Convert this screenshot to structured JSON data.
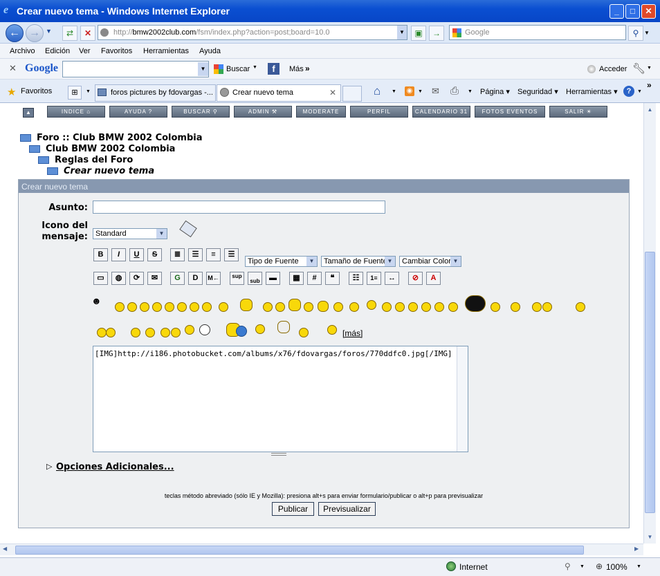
{
  "window": {
    "title": "Crear nuevo tema - Windows Internet Explorer"
  },
  "address": {
    "url_prefix": "http://",
    "url_domain": "bmw2002club.com",
    "url_path": "/fsm/index.php?action=post;board=10.0",
    "search_placeholder": "Google"
  },
  "menu": [
    "Archivo",
    "Edición",
    "Ver",
    "Favoritos",
    "Herramientas",
    "Ayuda"
  ],
  "google_bar": {
    "logo": "Google",
    "search_label": "Buscar",
    "more_label": "Más",
    "signin": "Acceder"
  },
  "favbar": {
    "favorites_label": "Favoritos",
    "tabs": [
      "foros pictures by fdovargas -...",
      "Crear nuevo tema"
    ],
    "tools": [
      "Página",
      "Seguridad",
      "Herramientas"
    ]
  },
  "forum_nav": [
    "INDICE",
    "AYUDA",
    "BUSCAR",
    "ADMIN",
    "MODERATE",
    "PERFIL",
    "CALENDARIO",
    "FOTOS EVENTOS",
    "SALIR"
  ],
  "breadcrumbs": [
    "Foro :: Club BMW 2002 Colombia",
    "Club BMW 2002 Colombia",
    "Reglas del Foro",
    "Crear nuevo tema"
  ],
  "form": {
    "header": "Crear nuevo tema",
    "subject_label": "Asunto:",
    "subject_value": "",
    "icon_label_line1": "Icono del",
    "icon_label_line2": "mensaje:",
    "icon_value": "Standard",
    "font_type": "Tipo de Fuente",
    "font_size": "Tamaño de Fuente",
    "font_color": "Cambiar Color",
    "more_smileys": "[más]",
    "message": "[IMG]http://i186.photobucket.com/albums/x76/fdovargas/foros/770ddfc0.jpg[/IMG]",
    "additional_options": "Opciones Adicionales...",
    "shortcut_hint": "teclas método abreviado (sólo IE y Mozilla): presiona alt+s para enviar formulario/publicar o alt+p para previsualizar",
    "submit_label": "Publicar",
    "preview_label": "Previsualizar"
  },
  "status": {
    "zone": "Internet",
    "zoom": "100%"
  }
}
